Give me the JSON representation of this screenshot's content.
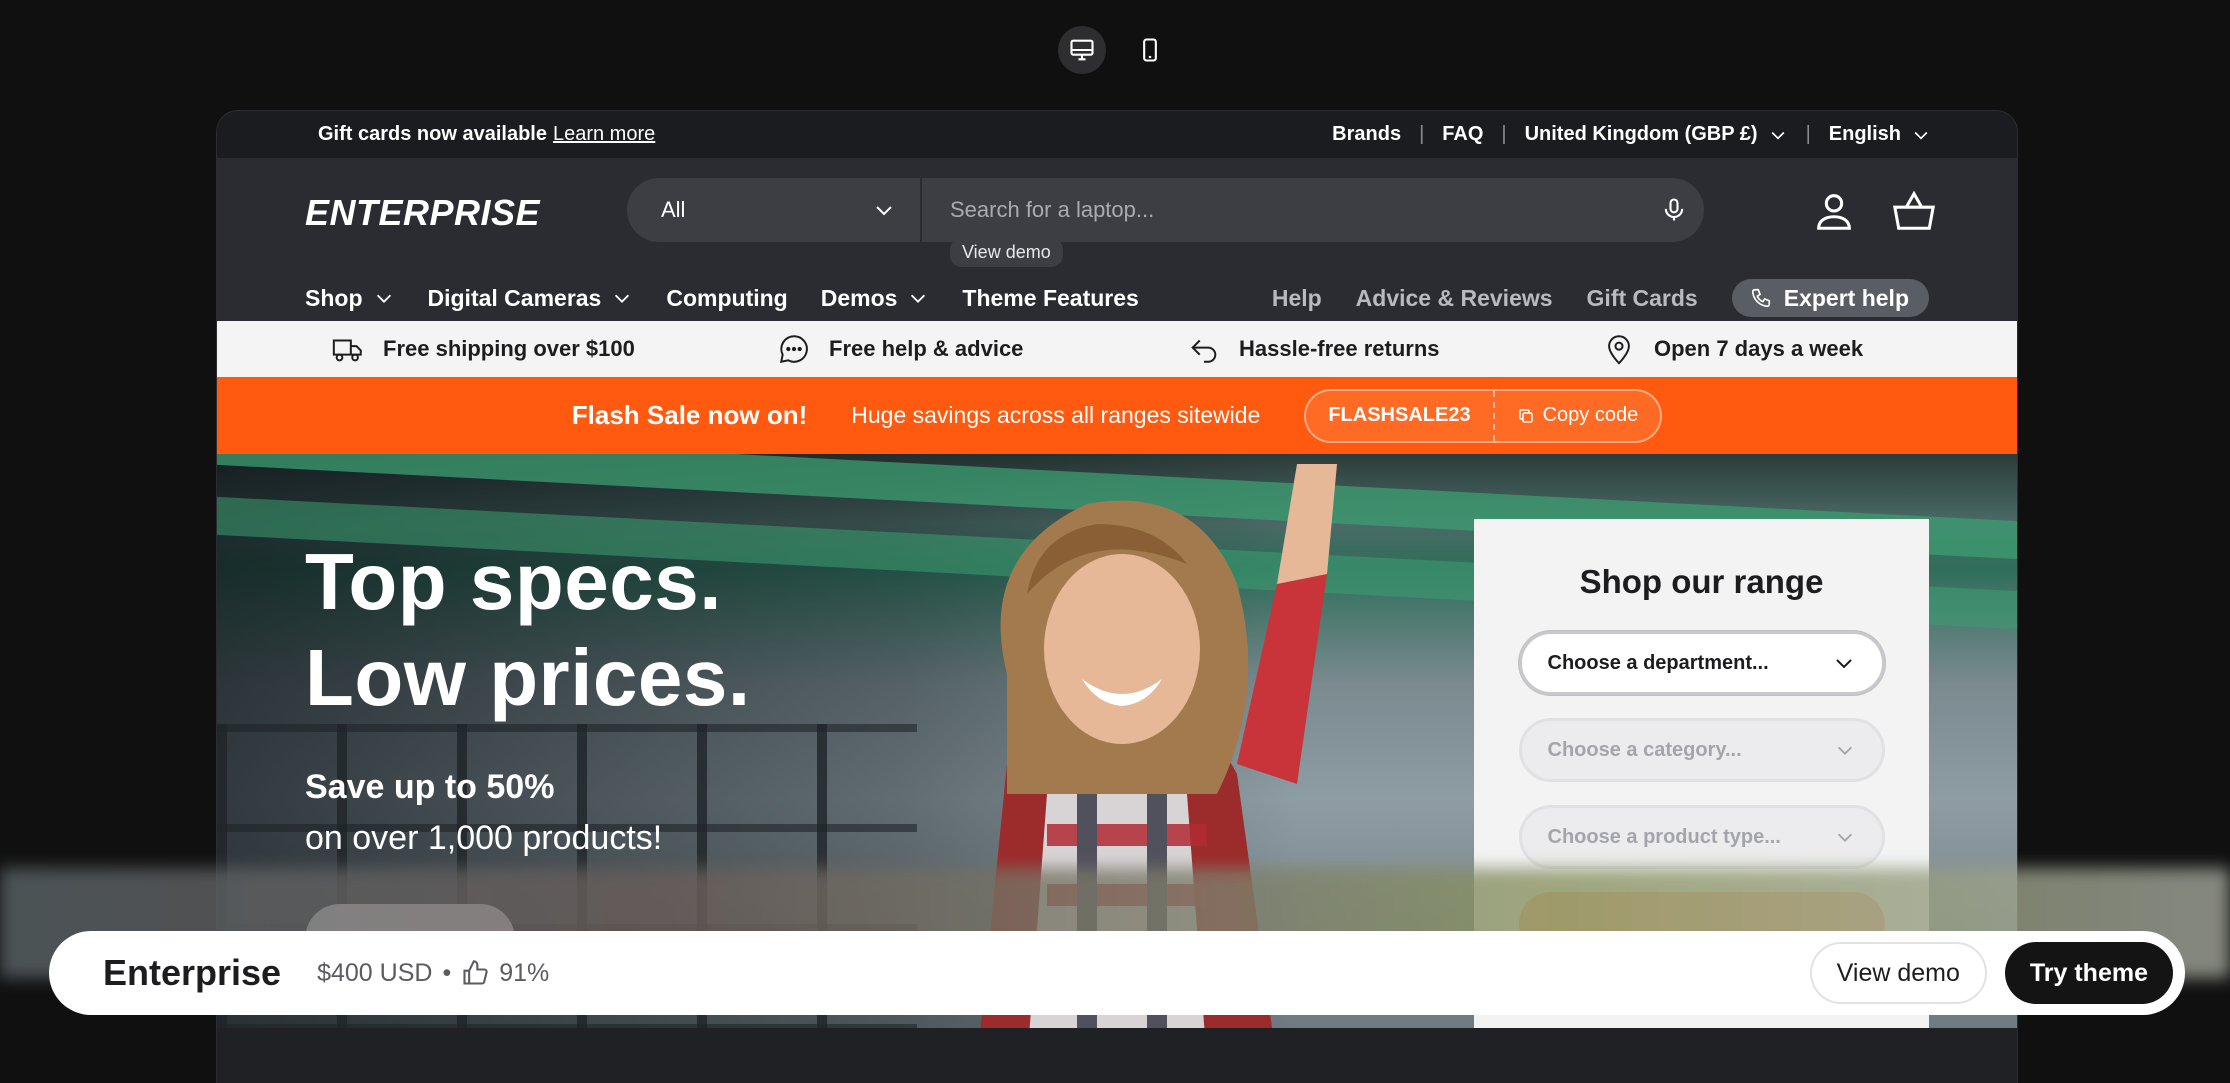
{
  "device_toggle": {
    "desktop_icon": "desktop-icon",
    "mobile_icon": "mobile-icon"
  },
  "topbar": {
    "announcement": "Gift cards now available",
    "announcement_link": "Learn more",
    "links": [
      "Brands",
      "FAQ"
    ],
    "country": "United Kingdom (GBP £)",
    "language": "English",
    "separator": "|"
  },
  "header": {
    "logo": "ENTERPRISE",
    "search_category": "All",
    "search_placeholder": "Search for a laptop...",
    "tooltip": "View demo"
  },
  "nav": {
    "left": [
      "Shop",
      "Digital Cameras",
      "Computing",
      "Demos",
      "Theme Features"
    ],
    "right": [
      "Help",
      "Advice & Reviews",
      "Gift Cards"
    ],
    "expert": "Expert help"
  },
  "usps": [
    "Free shipping over $100",
    "Free help & advice",
    "Hassle-free returns",
    "Open 7 days a week"
  ],
  "promo": {
    "headline": "Flash Sale now on!",
    "text": "Huge savings across all ranges sitewide",
    "code": "FLASHSALE23",
    "copy": "Copy code"
  },
  "hero": {
    "line1": "Top specs.",
    "line2": "Low prices.",
    "sub1": "Save up to 50%",
    "sub2": "on over 1,000 products!"
  },
  "finder": {
    "title": "Shop our range",
    "department": "Choose a department...",
    "category": "Choose a category...",
    "product_type": "Choose a product type..."
  },
  "themebar": {
    "name": "Enterprise",
    "price": "$400 USD",
    "bullet": "•",
    "rating": "91%",
    "view_demo": "View demo",
    "try_theme": "Try theme"
  },
  "colors": {
    "accent": "#ff5a0f",
    "header_bg": "#2a2c31",
    "page_bg": "#101010"
  }
}
